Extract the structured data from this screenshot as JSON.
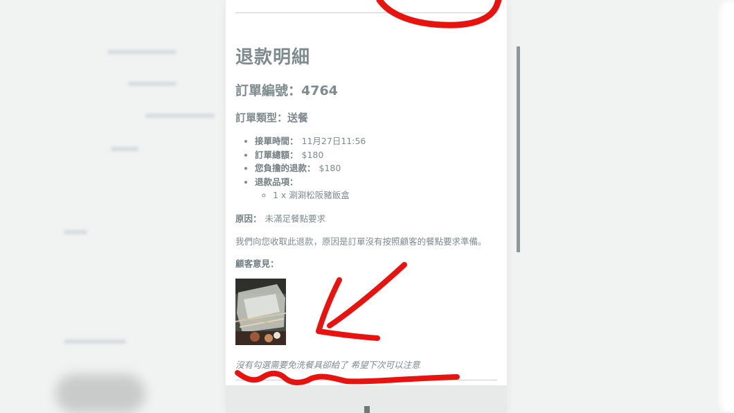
{
  "receipt": {
    "title": "退款明細",
    "order_number_label": "訂單編號：",
    "order_number": "4764",
    "order_type_label": "訂單類型：",
    "order_type": "送餐",
    "details": [
      {
        "label": "接單時間：",
        "value": "11月27日11:56"
      },
      {
        "label": "訂單總額：",
        "value": "$180"
      },
      {
        "label": "您負擔的退款：",
        "value": "$180"
      },
      {
        "label": "退款品項：",
        "value": ""
      }
    ],
    "refund_items": [
      "1 x 涮涮松阪豬飯盒"
    ],
    "reason_label": "原因：",
    "reason": "未滿足餐點要求",
    "explanation": "我們向您收取此退款，原因是訂單沒有按照顧客的餐點要求準備。",
    "feedback_label": "顧客意見：",
    "customer_comment": "沒有勾選需要免洗餐具卻給了 希望下次可以注意"
  },
  "colors": {
    "text": "#7f8a8e",
    "annotation": "#e8130f",
    "panel": "#ffffff",
    "background": "#f1f3f3"
  },
  "icons": {
    "photo": "customer-food-photo"
  }
}
